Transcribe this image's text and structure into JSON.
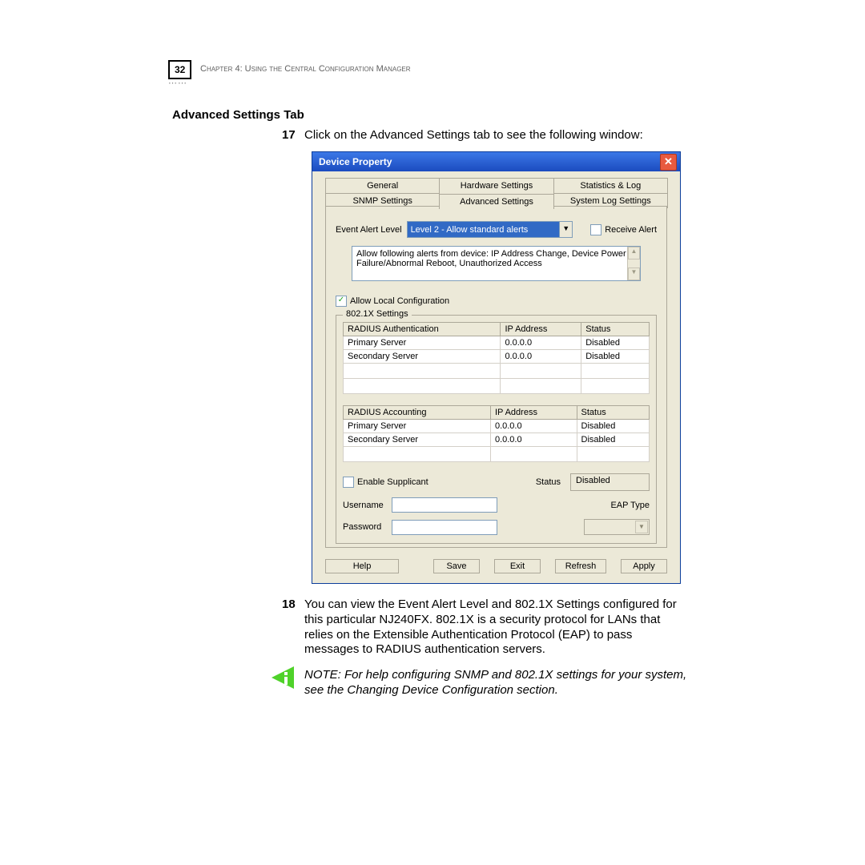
{
  "header": {
    "page_number": "32",
    "chapter_line": "Chapter 4: Using the Central Configuration Manager"
  },
  "section_heading": "Advanced Settings Tab",
  "step17": {
    "num": "17",
    "text": "Click on the Advanced Settings tab to see the following window:"
  },
  "step18": {
    "num": "18",
    "text": "You can view the Event Alert Level and 802.1X Settings configured for this particular NJ240FX. 802.1X is a security protocol for LANs that relies on the Extensible Authentication Protocol (EAP) to pass messages to RADIUS authentication servers."
  },
  "note": "NOTE:  For help configuring SNMP and 802.1X settings for your system, see the Changing Device Configuration section.",
  "dialog": {
    "title": "Device Property",
    "tabs_row1": [
      "General",
      "Hardware Settings",
      "Statistics & Log"
    ],
    "tabs_row2": [
      "SNMP Settings",
      "Advanced Settings",
      "System Log Settings"
    ],
    "active_tab": "Advanced Settings",
    "event_alert_label": "Event Alert Level",
    "event_alert_value": "Level 2 - Allow standard alerts",
    "receive_alert_label": "Receive Alert",
    "receive_alert_checked": false,
    "alert_description": "Allow following alerts from device: IP Address Change, Device Power Failure/Abnormal Reboot, Unauthorized Access",
    "allow_local_label": "Allow Local Configuration",
    "allow_local_checked": true,
    "dot1x_legend": "802.1X Settings",
    "auth_table": {
      "headers": [
        "RADIUS Authentication",
        "IP Address",
        "Status"
      ],
      "rows": [
        [
          "Primary Server",
          "0.0.0.0",
          "Disabled"
        ],
        [
          "Secondary Server",
          "0.0.0.0",
          "Disabled"
        ]
      ]
    },
    "acct_table": {
      "headers": [
        "RADIUS Accounting",
        "IP Address",
        "Status"
      ],
      "rows": [
        [
          "Primary Server",
          "0.0.0.0",
          "Disabled"
        ],
        [
          "Secondary Server",
          "0.0.0.0",
          "Disabled"
        ]
      ]
    },
    "enable_supplicant_label": "Enable Supplicant",
    "enable_supplicant_checked": false,
    "status_label": "Status",
    "status_value": "Disabled",
    "username_label": "Username",
    "username_value": "",
    "password_label": "Password",
    "password_value": "",
    "eap_label": "EAP Type",
    "eap_value": "",
    "buttons": {
      "help": "Help",
      "save": "Save",
      "exit": "Exit",
      "refresh": "Refresh",
      "apply": "Apply"
    }
  }
}
